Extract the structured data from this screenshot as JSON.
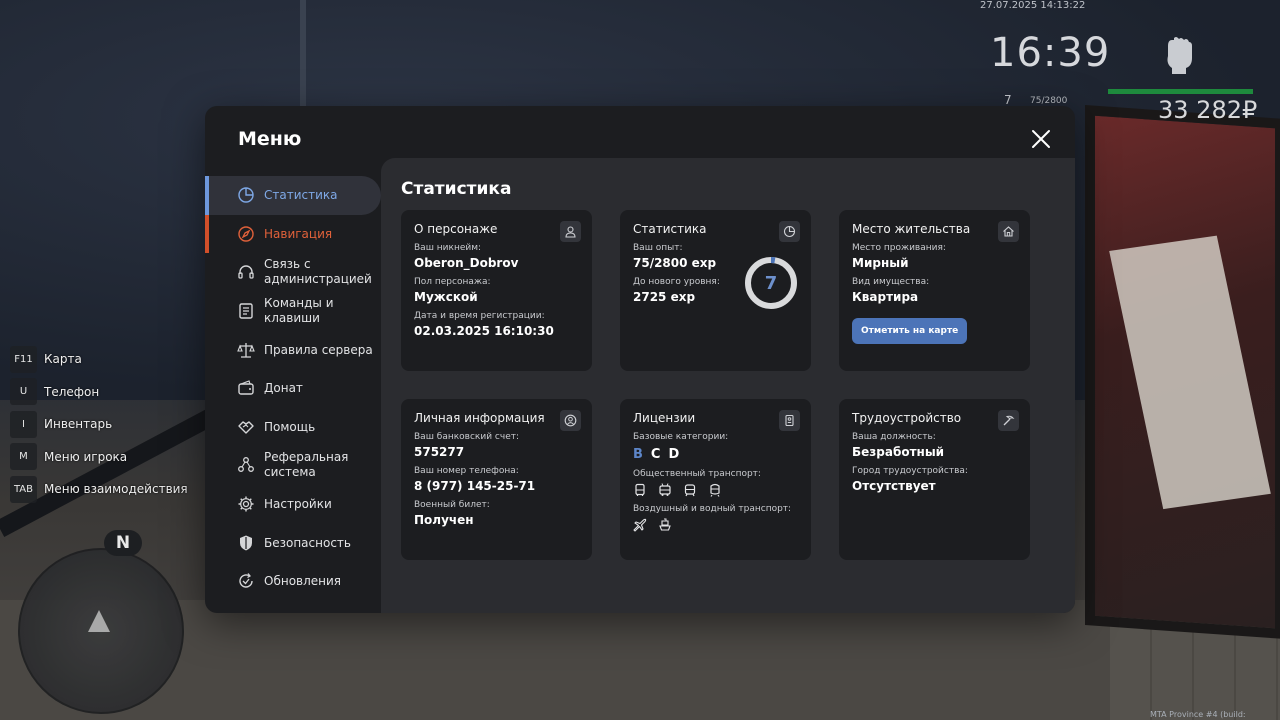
{
  "hud": {
    "datetime": "27.07.2025 14:13:22",
    "clock": "16:39",
    "level": "7",
    "exp": "75/2800",
    "money": "33 282₽"
  },
  "hotkeys": [
    {
      "key": "F11",
      "label": "Карта"
    },
    {
      "key": "U",
      "label": "Телефон"
    },
    {
      "key": "I",
      "label": "Инвентарь"
    },
    {
      "key": "M",
      "label": "Меню игрока"
    },
    {
      "key": "TAB",
      "label": "Меню взаимодействия"
    }
  ],
  "radar": {
    "north": "N"
  },
  "build": "MTA Province #4 (build: 6.12415.9)",
  "menu": {
    "title": "Меню",
    "sidebar": [
      {
        "label": "Статистика",
        "icon": "chart-pie-icon"
      },
      {
        "label": "Навигация",
        "icon": "compass-icon"
      },
      {
        "label": "Связь с администрацией",
        "icon": "headset-icon"
      },
      {
        "label": "Команды и клавиши",
        "icon": "document-icon"
      },
      {
        "label": "Правила сервера",
        "icon": "scales-icon"
      },
      {
        "label": "Донат",
        "icon": "wallet-icon"
      },
      {
        "label": "Помощь",
        "icon": "handshake-icon"
      },
      {
        "label": "Реферальная система",
        "icon": "network-icon"
      },
      {
        "label": "Настройки",
        "icon": "gear-icon"
      },
      {
        "label": "Безопасность",
        "icon": "shield-icon"
      },
      {
        "label": "Обновления",
        "icon": "refresh-icon"
      }
    ],
    "content_title": "Статистика",
    "cards": {
      "character": {
        "title": "О персонаже",
        "nickname_label": "Ваш никнейм:",
        "nickname": "Oberon_Dobrov",
        "gender_label": "Пол персонажа:",
        "gender": "Мужской",
        "reg_label": "Дата и время регистрации:",
        "reg": "02.03.2025 16:10:30"
      },
      "stats": {
        "title": "Статистика",
        "exp_label": "Ваш опыт:",
        "exp": "75/2800 exp",
        "next_label": "До нового уровня:",
        "next": "2725 exp",
        "level": "7",
        "progress": 0.027
      },
      "residence": {
        "title": "Место жительства",
        "place_label": "Место проживания:",
        "place": "Мирный",
        "property_label": "Вид имущества:",
        "property": "Квартира",
        "button": "Отметить на карте"
      },
      "personal": {
        "title": "Личная информация",
        "bank_label": "Ваш банковский счет:",
        "bank": "575277",
        "phone_label": "Ваш номер телефона:",
        "phone": "8 (977) 145-25-71",
        "military_label": "Военный билет:",
        "military": "Получен"
      },
      "licenses": {
        "title": "Лицензии",
        "base_label": "Базовые категории:",
        "categories": [
          "B",
          "C",
          "D"
        ],
        "public_label": "Общественный транспорт:",
        "air_label": "Воздушный и водный транспорт:"
      },
      "job": {
        "title": "Трудоустройство",
        "position_label": "Ваша должность:",
        "position": "Безработный",
        "city_label": "Город трудоустройства:",
        "city": "Отсутствует"
      }
    }
  }
}
